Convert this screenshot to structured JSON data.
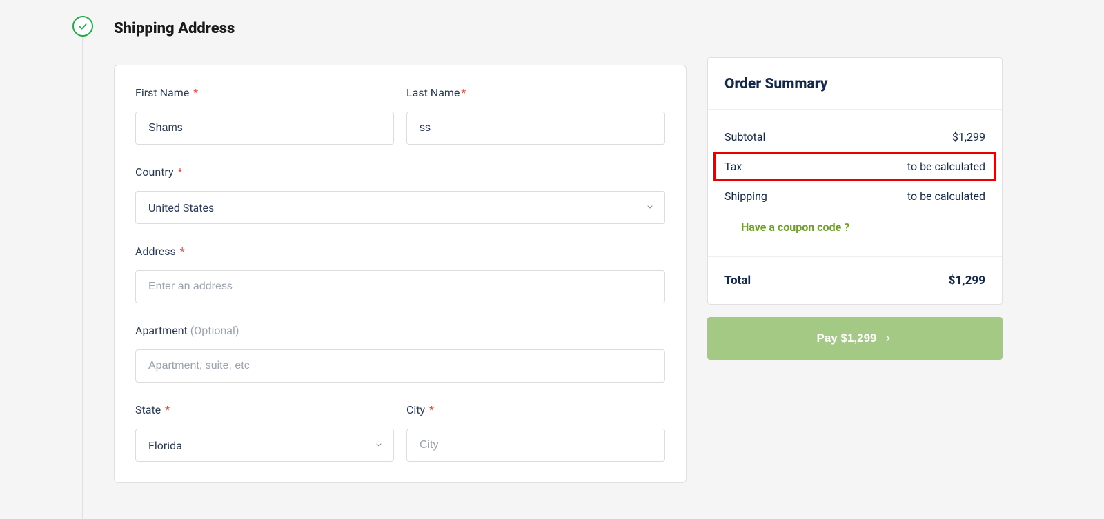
{
  "heading": "Shipping Address",
  "form": {
    "firstName": {
      "label": "First Name",
      "required": "*",
      "value": "Shams"
    },
    "lastName": {
      "label": "Last Name",
      "required": "*",
      "value": "ss"
    },
    "country": {
      "label": "Country",
      "required": "*",
      "value": "United States"
    },
    "address": {
      "label": "Address",
      "required": "*",
      "placeholder": "Enter an address"
    },
    "apartment": {
      "label": "Apartment",
      "optional": "(Optional)",
      "placeholder": "Apartment, suite, etc"
    },
    "state": {
      "label": "State",
      "required": "*",
      "value": "Florida"
    },
    "city": {
      "label": "City",
      "required": "*",
      "placeholder": "City"
    }
  },
  "summary": {
    "title": "Order Summary",
    "subtotal": {
      "label": "Subtotal",
      "value": "$1,299"
    },
    "tax": {
      "label": "Tax",
      "value": "to be calculated"
    },
    "shipping": {
      "label": "Shipping",
      "value": "to be calculated"
    },
    "coupon": "Have a coupon code ?",
    "total": {
      "label": "Total",
      "value": "$1,299"
    },
    "payLabel": "Pay $1,299"
  }
}
